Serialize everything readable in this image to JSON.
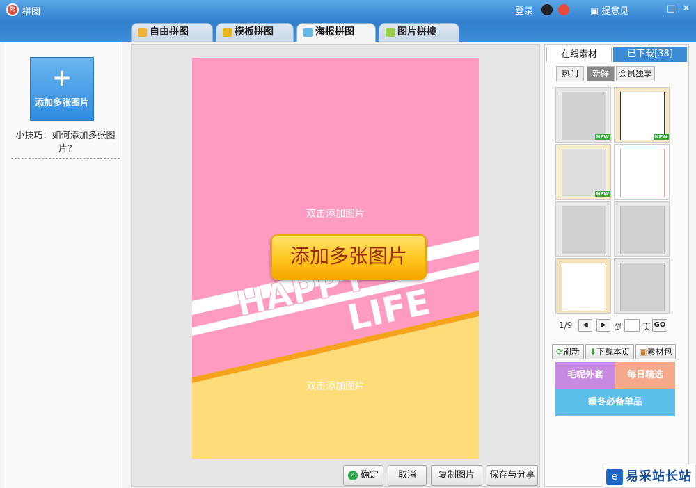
{
  "window": {
    "title": "拼图",
    "icon_text": "秀",
    "login": "登录",
    "feedback": "提意见"
  },
  "tabs": [
    {
      "label": "自由拼图"
    },
    {
      "label": "模板拼图"
    },
    {
      "label": "海报拼图"
    },
    {
      "label": "图片拼接"
    }
  ],
  "left": {
    "add_label": "添加多张图片",
    "add_plus": "+",
    "tip": "小技巧：如何添加多张图片?"
  },
  "poster": {
    "placeholder_top": "双击添加图片",
    "placeholder_bottom": "双击添加图片",
    "add_button": "添加多张图片",
    "banner1": "HAPPY",
    "banner2": "LIFE"
  },
  "buttons": {
    "confirm": "确定",
    "cancel": "取消",
    "copy": "复制图片",
    "save_share": "保存与分享"
  },
  "right": {
    "tab_online": "在线素材",
    "tab_downloaded": "已下载[38]",
    "categories": [
      "热门",
      "新鲜",
      "会员独享"
    ],
    "new_badge": "NEW",
    "pager": {
      "page": "1/9",
      "goto": "到",
      "unit": "页",
      "go": "GO"
    },
    "actions": {
      "refresh": "刷新",
      "download_page": "下载本页",
      "pack": "素材包"
    },
    "ads": [
      "毛呢外套",
      "每日精选",
      "暖冬必备单品"
    ]
  },
  "watermark": "易采站长站",
  "colors": {
    "accent": "#3c8ad0",
    "poster_pink": "#ff9ac0",
    "poster_yellow": "#ffdc7a",
    "button_yellow": "#ffc21a"
  }
}
